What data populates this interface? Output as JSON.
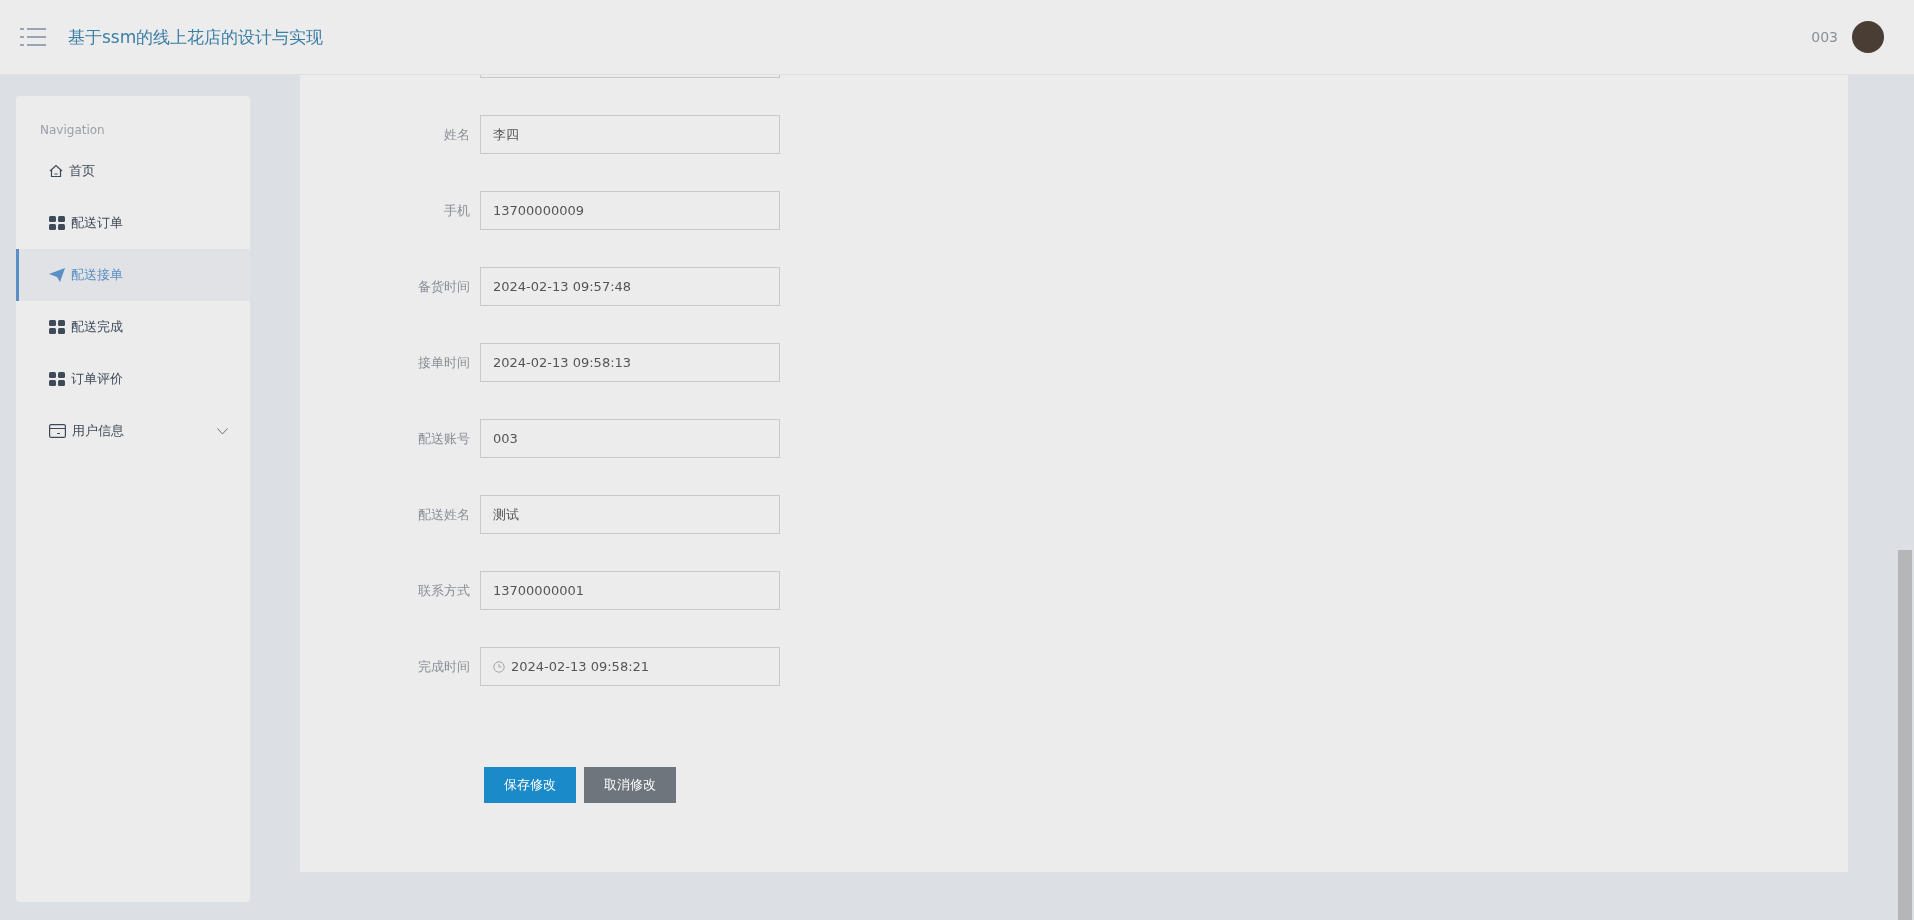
{
  "header": {
    "title": "基于ssm的线上花店的设计与实现",
    "username": "003"
  },
  "sidebar": {
    "heading": "Navigation",
    "items": [
      {
        "label": "首页",
        "kind": "home",
        "selected": false,
        "expandable": false
      },
      {
        "label": "配送订单",
        "kind": "grid",
        "selected": false,
        "expandable": false
      },
      {
        "label": "配送接单",
        "kind": "send",
        "selected": true,
        "expandable": false
      },
      {
        "label": "配送完成",
        "kind": "grid",
        "selected": false,
        "expandable": false
      },
      {
        "label": "订单评价",
        "kind": "grid",
        "selected": false,
        "expandable": false
      },
      {
        "label": "用户信息",
        "kind": "card",
        "selected": false,
        "expandable": true
      }
    ]
  },
  "form": {
    "fields": [
      {
        "label": "姓名",
        "value": "李四",
        "kind": "text"
      },
      {
        "label": "手机",
        "value": "13700000009",
        "kind": "text"
      },
      {
        "label": "备货时间",
        "value": "2024-02-13 09:57:48",
        "kind": "text"
      },
      {
        "label": "接单时间",
        "value": "2024-02-13 09:58:13",
        "kind": "text"
      },
      {
        "label": "配送账号",
        "value": "003",
        "kind": "text"
      },
      {
        "label": "配送姓名",
        "value": "测试",
        "kind": "text"
      },
      {
        "label": "联系方式",
        "value": "13700000001",
        "kind": "text"
      },
      {
        "label": "完成时间",
        "value": "2024-02-13 09:58:21",
        "kind": "datetime"
      }
    ],
    "buttons": [
      {
        "label": "保存修改",
        "kind": "primary"
      },
      {
        "label": "取消修改",
        "kind": "secondary"
      }
    ]
  }
}
